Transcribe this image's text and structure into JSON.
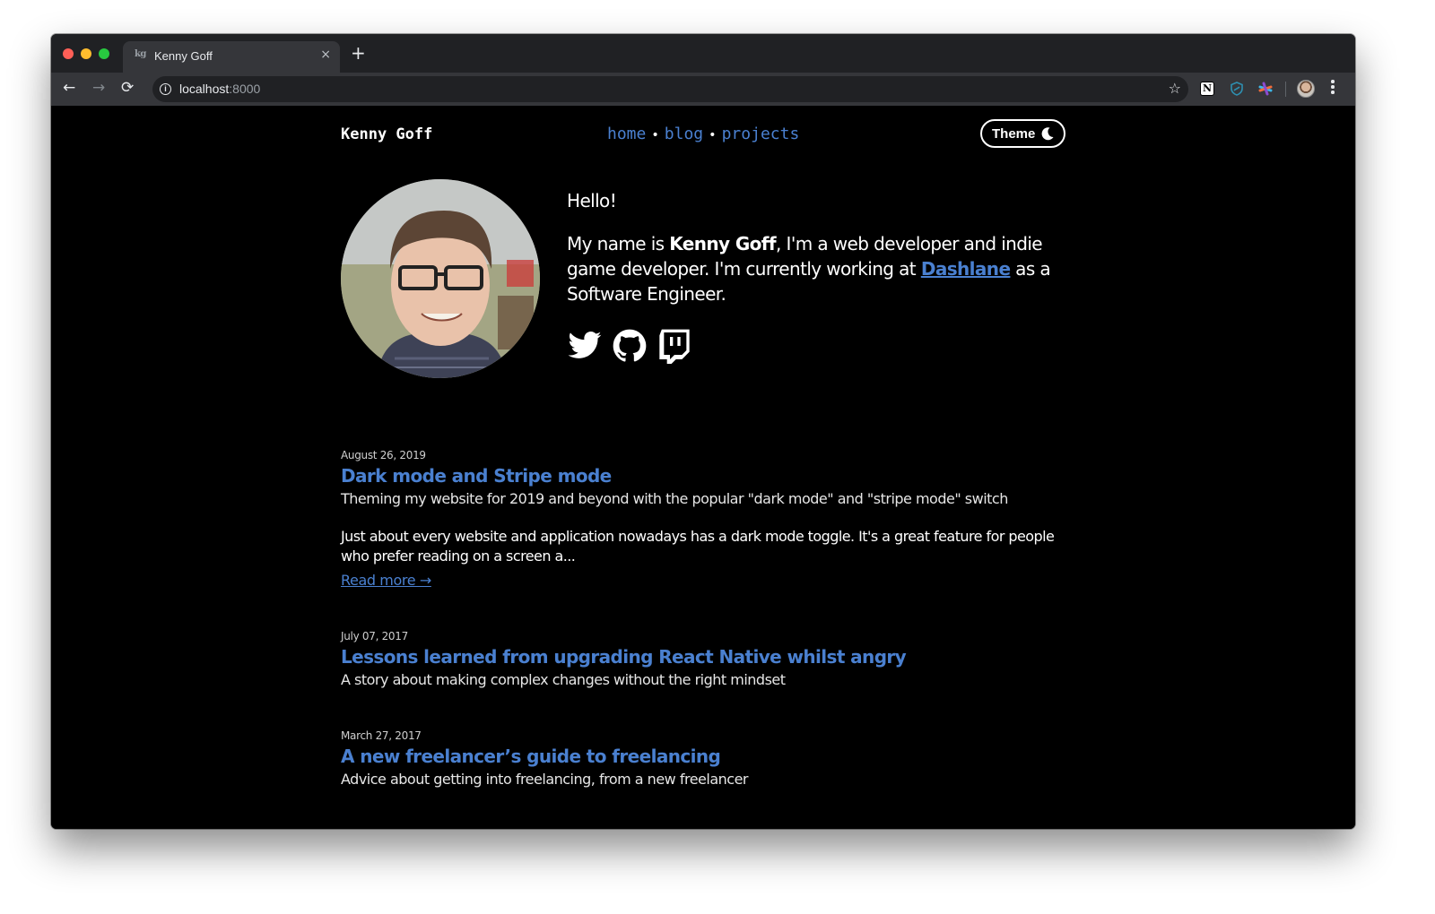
{
  "browser": {
    "tab": {
      "favicon_text": "kg",
      "title": "Kenny Goff",
      "close_glyph": "×"
    },
    "new_tab_glyph": "+",
    "nav": {
      "back_glyph": "←",
      "forward_glyph": "→",
      "reload_glyph": "⟳"
    },
    "address": {
      "host": "localhost",
      "port": ":8000"
    },
    "bookmark_glyph": "☆",
    "extensions": [
      "notion-icon",
      "shield-extension-icon",
      "asterisk-extension-icon"
    ],
    "notion_glyph": "N"
  },
  "header": {
    "site_title": "Kenny Goff",
    "nav": [
      {
        "label": "home"
      },
      {
        "label": "blog"
      },
      {
        "label": "projects"
      }
    ],
    "nav_separator": "•",
    "theme_button_label": "Theme"
  },
  "intro": {
    "greeting": "Hello!",
    "bio_prefix": "My name is ",
    "bio_name": "Kenny Goff",
    "bio_middle": ", I'm a web developer and indie game developer. I'm currently working at ",
    "bio_company": "Dashlane",
    "bio_suffix": " as a Software Engineer.",
    "socials": [
      "twitter",
      "github",
      "twitch"
    ]
  },
  "posts": [
    {
      "date": "August 26, 2019",
      "title": "Dark mode and Stripe mode",
      "description": "Theming my website for 2019 and beyond with the popular \"dark mode\" and \"stripe mode\" switch",
      "excerpt": "Just about every website and application nowadays has a dark mode toggle. It's a great feature for people who prefer reading on a screen a...",
      "read_more": "Read more →"
    },
    {
      "date": "July 07, 2017",
      "title": "Lessons learned from upgrading React Native whilst angry",
      "description": "A story about making complex changes without the right mindset"
    },
    {
      "date": "March 27, 2017",
      "title": "A new freelancer’s guide to freelancing",
      "description": "Advice about getting into freelancing, from a new freelancer"
    }
  ],
  "colors": {
    "link": "#4a80d0",
    "background": "#000000",
    "text": "#ffffff",
    "chrome_tabstrip": "#202124",
    "chrome_toolbar": "#35363a"
  }
}
